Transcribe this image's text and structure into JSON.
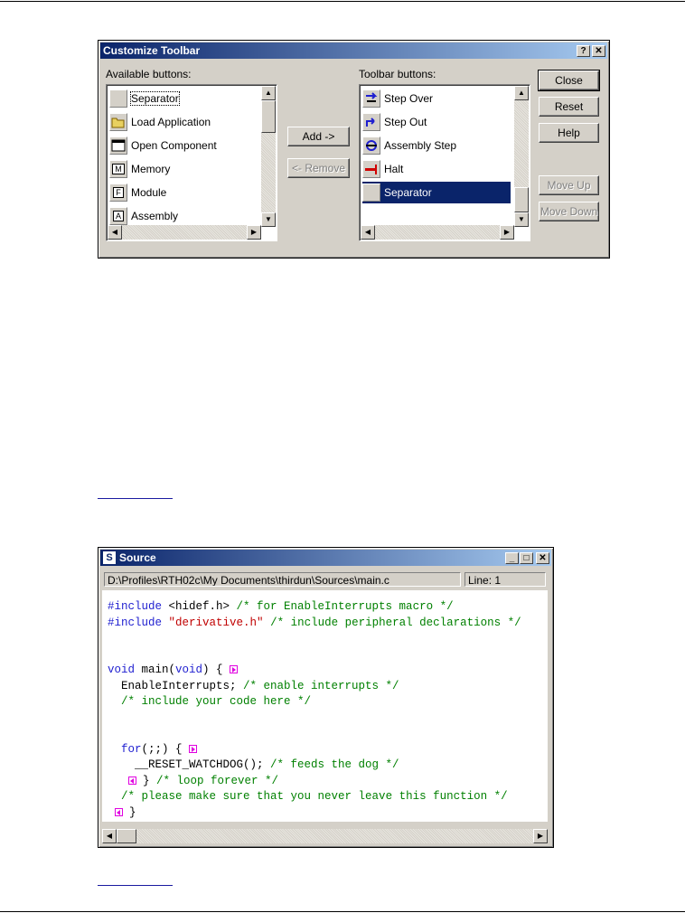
{
  "customize_toolbar": {
    "title": "Customize Toolbar",
    "help_glyph": "?",
    "close_glyph": "✕",
    "available_label": "Available buttons:",
    "toolbar_label": "Toolbar buttons:",
    "available_items": [
      {
        "label": "Separator",
        "icon": "separator-icon"
      },
      {
        "label": "Load Application",
        "icon": "folder-open-icon"
      },
      {
        "label": "Open Component",
        "icon": "window-icon"
      },
      {
        "label": "Memory",
        "icon": "memory-icon",
        "glyph": "M"
      },
      {
        "label": "Module",
        "icon": "module-icon",
        "glyph": "F"
      },
      {
        "label": "Assembly",
        "icon": "assembly-icon",
        "glyph": "A"
      }
    ],
    "toolbar_items": [
      {
        "label": "Step Over",
        "icon": "step-over-icon"
      },
      {
        "label": "Step Out",
        "icon": "step-out-icon"
      },
      {
        "label": "Assembly Step",
        "icon": "assembly-step-icon"
      },
      {
        "label": "Halt",
        "icon": "halt-icon"
      },
      {
        "label": "Separator",
        "icon": "separator-icon",
        "selected": true
      }
    ],
    "buttons": {
      "add": "Add ->",
      "remove": "<- Remove",
      "close": "Close",
      "reset": "Reset",
      "help": "Help",
      "move_up": "Move Up",
      "move_down": "Move Down"
    }
  },
  "source_window": {
    "title": "Source",
    "title_icon": "S",
    "path": "D:\\Profiles\\RTH02c\\My Documents\\thirdun\\Sources\\main.c",
    "line": "Line: 1",
    "colors": {
      "keyword": "#1f1fd0",
      "string": "#c00000",
      "comment": "#008000",
      "fold_marker": "#e000e0"
    },
    "code_lines": [
      [
        {
          "t": "#include",
          "c": "kw"
        },
        {
          "t": " <hidef.h> "
        },
        {
          "t": "/* for EnableInterrupts macro */",
          "c": "cm"
        }
      ],
      [
        {
          "t": "#include",
          "c": "kw"
        },
        {
          "t": " "
        },
        {
          "t": "\"derivative.h\"",
          "c": "str"
        },
        {
          "t": " "
        },
        {
          "t": "/* include peripheral declarations */",
          "c": "cm"
        }
      ],
      [],
      [],
      [
        {
          "t": "void",
          "c": "kw"
        },
        {
          "t": " main("
        },
        {
          "t": "void",
          "c": "kw"
        },
        {
          "t": ") { "
        },
        {
          "t": "",
          "c": "fold"
        }
      ],
      [
        {
          "t": "  EnableInterrupts; "
        },
        {
          "t": "/* enable interrupts */",
          "c": "cm"
        }
      ],
      [
        {
          "t": "  "
        },
        {
          "t": "/* include your code here */",
          "c": "cm"
        }
      ],
      [],
      [],
      [
        {
          "t": "  "
        },
        {
          "t": "for",
          "c": "kw"
        },
        {
          "t": "(;;) { "
        },
        {
          "t": "",
          "c": "fold"
        }
      ],
      [
        {
          "t": "    __RESET_WATCHDOG(); "
        },
        {
          "t": "/* feeds the dog */",
          "c": "cm"
        }
      ],
      [
        {
          "t": "   "
        },
        {
          "t": "",
          "c": "foldl"
        },
        {
          "t": " } "
        },
        {
          "t": "/* loop forever */",
          "c": "cm"
        }
      ],
      [
        {
          "t": "  "
        },
        {
          "t": "/* please make sure that you never leave this function */",
          "c": "cm"
        }
      ],
      [
        {
          "t": " "
        },
        {
          "t": "",
          "c": "foldl"
        },
        {
          "t": " }"
        }
      ]
    ]
  }
}
